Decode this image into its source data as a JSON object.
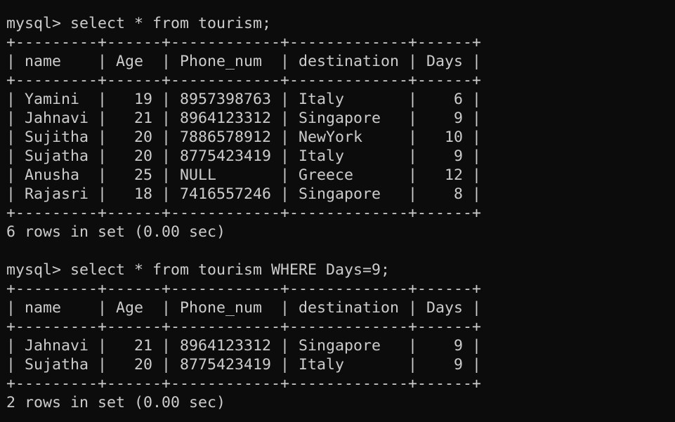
{
  "terminal": {
    "lines": [
      "mysql> select * from tourism;",
      "+---------+------+------------+-------------+------+",
      "| name    | Age  | Phone_num  | destination | Days |",
      "+---------+------+------------+-------------+------+",
      "| Yamini  |   19 | 8957398763 | Italy       |    6 |",
      "| Jahnavi |   21 | 8964123312 | Singapore   |    9 |",
      "| Sujitha |   20 | 7886578912 | NewYork     |   10 |",
      "| Sujatha |   20 | 8775423419 | Italy       |    9 |",
      "| Anusha  |   25 | NULL       | Greece      |   12 |",
      "| Rajasri |   18 | 7416557246 | Singapore   |    8 |",
      "+---------+------+------------+-------------+------+",
      "6 rows in set (0.00 sec)",
      "",
      "mysql> select * from tourism WHERE Days=9;",
      "+---------+------+------------+-------------+------+",
      "| name    | Age  | Phone_num  | destination | Days |",
      "+---------+------+------------+-------------+------+",
      "| Jahnavi |   21 | 8964123312 | Singapore   |    9 |",
      "| Sujatha |   20 | 8775423419 | Italy       |    9 |",
      "+---------+------+------------+-------------+------+",
      "2 rows in set (0.00 sec)"
    ]
  }
}
